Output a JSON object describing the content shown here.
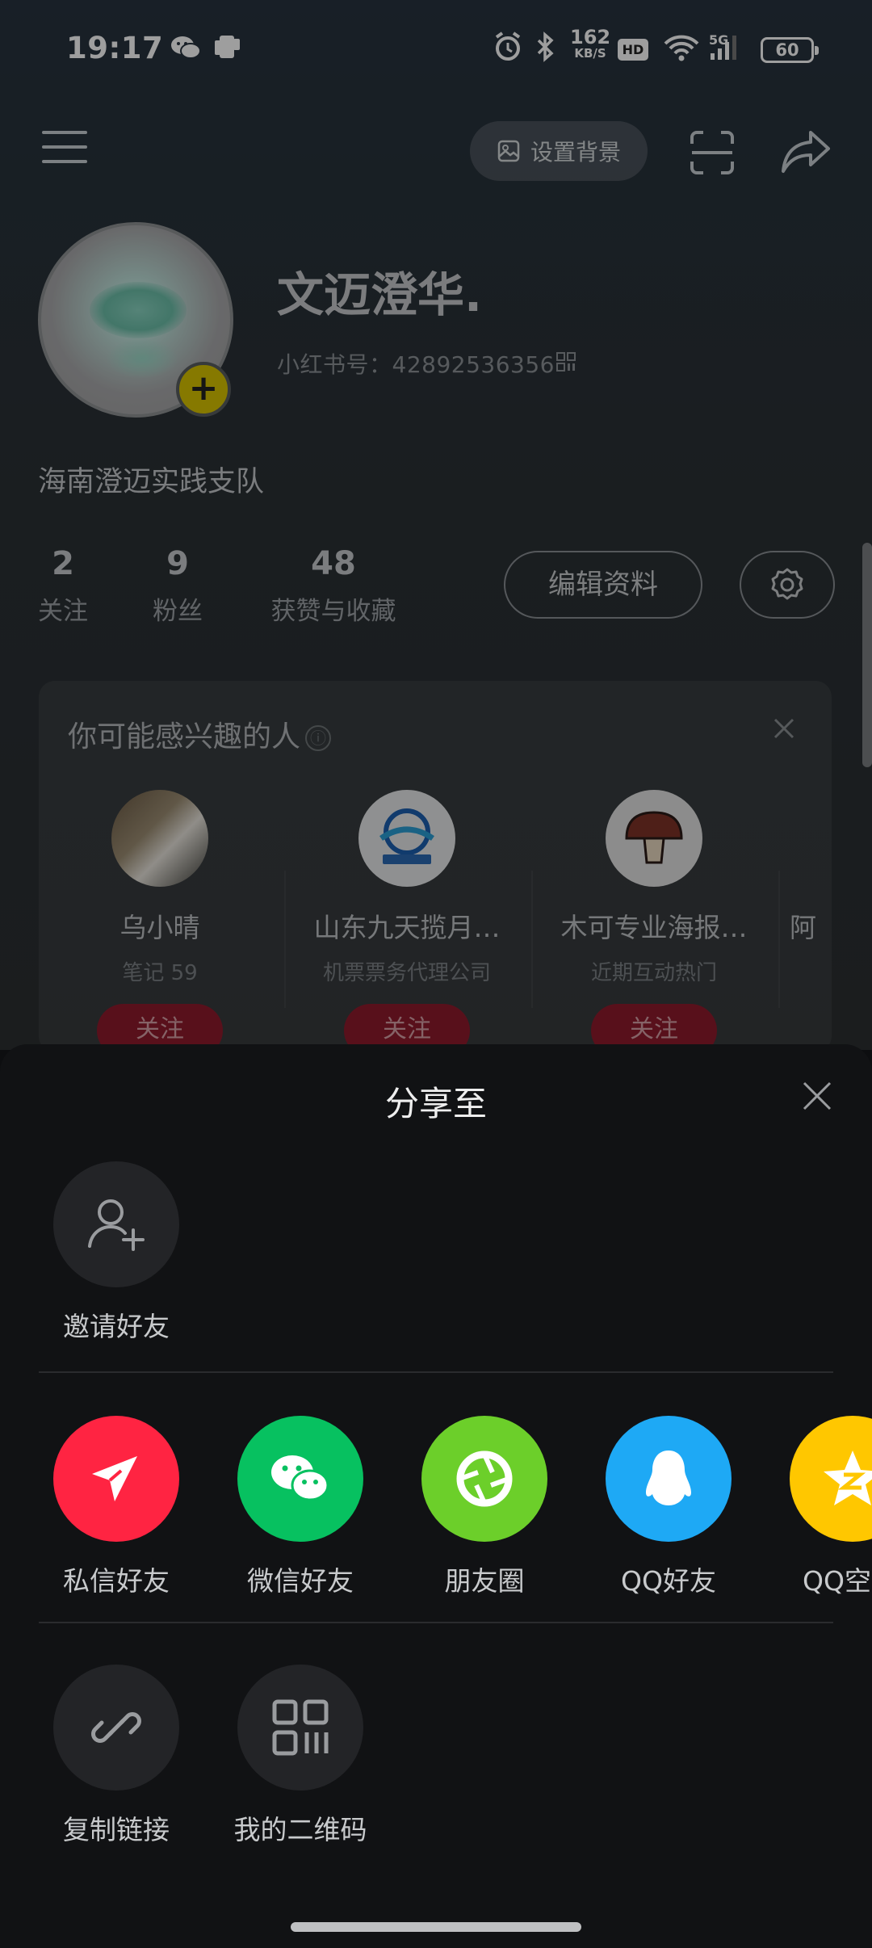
{
  "status_bar": {
    "time": "19:17",
    "net_speed_value": "162",
    "net_speed_unit": "KB/S",
    "hd_label": "HD",
    "signal_label": "5G",
    "battery": "60"
  },
  "top_nav": {
    "set_background_label": "设置背景"
  },
  "profile": {
    "nickname": "文迈澄华.",
    "red_id": "小红书号：42892536356",
    "bio": "海南澄迈实践支队",
    "stats": [
      {
        "value": "2",
        "label": "关注"
      },
      {
        "value": "9",
        "label": "粉丝"
      },
      {
        "value": "48",
        "label": "获赞与收藏"
      }
    ],
    "edit_profile_label": "编辑资料"
  },
  "suggestions": {
    "title": "你可能感兴趣的人",
    "info_icon": "ⓘ",
    "people": [
      {
        "name": "乌小晴",
        "sub": "笔记 59",
        "follow": "关注"
      },
      {
        "name": "山东九天揽月…",
        "sub": "机票票务代理公司",
        "follow": "关注"
      },
      {
        "name": "木可专业海报…",
        "sub": "近期互动热门",
        "follow": "关注"
      },
      {
        "name": "阿"
      }
    ]
  },
  "share_sheet": {
    "title": "分享至",
    "invite_label": "邀请好友",
    "apps": [
      {
        "label": "私信好友",
        "color": "#ff2442"
      },
      {
        "label": "微信好友",
        "color": "#07c160"
      },
      {
        "label": "朋友圈",
        "color": "#6ccf2a"
      },
      {
        "label": "QQ好友",
        "color": "#1ea9f5"
      },
      {
        "label": "QQ空",
        "color": "#ffc700"
      }
    ],
    "actions": [
      {
        "label": "复制链接"
      },
      {
        "label": "我的二维码"
      }
    ]
  }
}
